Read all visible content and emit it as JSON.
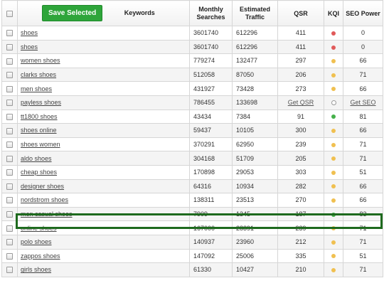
{
  "header": {
    "save_label": "Save Selected",
    "keywords": "Keywords",
    "monthly_searches": "Monthly Searches",
    "estimated_traffic": "Estimated Traffic",
    "qsr": "QSR",
    "kqi": "KQI",
    "seo_power": "SEO Power"
  },
  "colors": {
    "kqi_red": "#e05a5a",
    "kqi_yellow": "#f0c050",
    "kqi_green": "#45b04a",
    "highlight": "#1e6a1e",
    "button": "#2ea53a"
  },
  "rows": [
    {
      "keyword": "shoes",
      "searches": "3601740",
      "traffic": "612296",
      "qsr": "411",
      "kqi": "red",
      "seo": "0"
    },
    {
      "keyword": "shoes",
      "searches": "3601740",
      "traffic": "612296",
      "qsr": "411",
      "kqi": "red",
      "seo": "0"
    },
    {
      "keyword": "women shoes",
      "searches": "779274",
      "traffic": "132477",
      "qsr": "297",
      "kqi": "yellow",
      "seo": "66"
    },
    {
      "keyword": "clarks shoes",
      "searches": "512058",
      "traffic": "87050",
      "qsr": "206",
      "kqi": "yellow",
      "seo": "71"
    },
    {
      "keyword": "men shoes",
      "searches": "431927",
      "traffic": "73428",
      "qsr": "273",
      "kqi": "yellow",
      "seo": "66"
    },
    {
      "keyword": "payless shoes",
      "searches": "786455",
      "traffic": "133698",
      "qsr": "Get QSR",
      "kqi": "empty",
      "seo": "Get SEO"
    },
    {
      "keyword": "tt1800 shoes",
      "searches": "43434",
      "traffic": "7384",
      "qsr": "91",
      "kqi": "green",
      "seo": "81"
    },
    {
      "keyword": "shoes online",
      "searches": "59437",
      "traffic": "10105",
      "qsr": "300",
      "kqi": "yellow",
      "seo": "66"
    },
    {
      "keyword": "shoes women",
      "searches": "370291",
      "traffic": "62950",
      "qsr": "239",
      "kqi": "yellow",
      "seo": "71"
    },
    {
      "keyword": "aldo shoes",
      "searches": "304168",
      "traffic": "51709",
      "qsr": "205",
      "kqi": "yellow",
      "seo": "71"
    },
    {
      "keyword": "cheap shoes",
      "searches": "170898",
      "traffic": "29053",
      "qsr": "303",
      "kqi": "yellow",
      "seo": "51"
    },
    {
      "keyword": "designer shoes",
      "searches": "64316",
      "traffic": "10934",
      "qsr": "282",
      "kqi": "yellow",
      "seo": "66"
    },
    {
      "keyword": "nordstrom shoes",
      "searches": "138311",
      "traffic": "23513",
      "qsr": "270",
      "kqi": "yellow",
      "seo": "66"
    },
    {
      "keyword": "men casual shoes",
      "searches": "7909",
      "traffic": "1345",
      "qsr": "187",
      "kqi": "green",
      "seo": "83"
    },
    {
      "keyword": "online shoes",
      "searches": "167000",
      "traffic": "28391",
      "qsr": "239",
      "kqi": "yellow",
      "seo": "71"
    },
    {
      "keyword": "polo shoes",
      "searches": "140937",
      "traffic": "23960",
      "qsr": "212",
      "kqi": "yellow",
      "seo": "71"
    },
    {
      "keyword": "zappos shoes",
      "searches": "147092",
      "traffic": "25006",
      "qsr": "335",
      "kqi": "yellow",
      "seo": "51"
    },
    {
      "keyword": "girls shoes",
      "searches": "61330",
      "traffic": "10427",
      "qsr": "210",
      "kqi": "yellow",
      "seo": "71"
    }
  ]
}
